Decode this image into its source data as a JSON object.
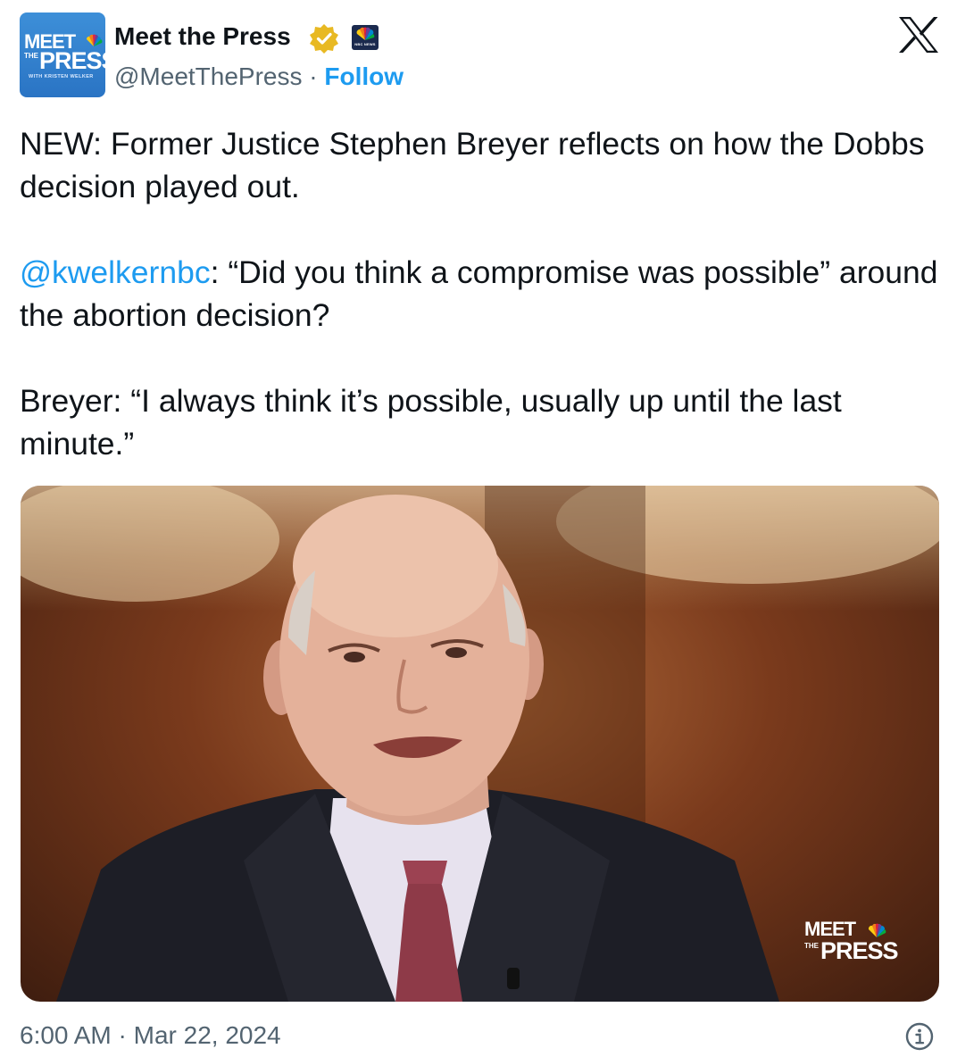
{
  "author": {
    "avatar": {
      "line1": "MEET",
      "line2_small": "THE",
      "line2": "PRESS",
      "subline": "WITH KRISTEN WELKER"
    },
    "display_name": "Meet the Press",
    "verified_icon": "verified-badge-gold",
    "affiliate_badge": {
      "icon": "nbc-news-logo",
      "text": "NBC NEWS"
    },
    "handle": "@MeetThePress",
    "separator": "·",
    "follow_label": "Follow"
  },
  "platform_icon": "x-logo",
  "tweet": {
    "line1": "NEW: Former Justice Stephen Breyer reflects on how the Dobbs decision played out.",
    "mention": "@kwelkernbc",
    "line2_rest": ": “Did you think a compromise was possible” around the abortion decision?",
    "line3": "Breyer:  “I always think it’s possible, usually up until the last minute.”"
  },
  "media": {
    "watermark": {
      "line1": "MEET",
      "line2_small": "THE",
      "line2": "PRESS"
    }
  },
  "footer": {
    "time": "6:00 AM",
    "separator": "·",
    "date": "Mar 22, 2024",
    "info_icon": "info-icon"
  },
  "colors": {
    "accent": "#1d9bf0",
    "secondary_text": "#536471",
    "verified_gold": "#e8b923",
    "avatar_blue": "#2f7fd0"
  }
}
